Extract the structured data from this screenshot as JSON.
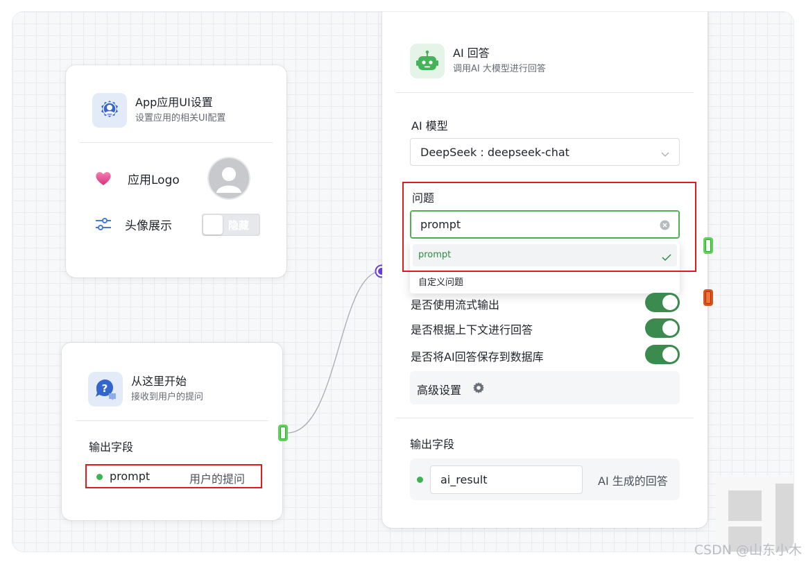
{
  "ui_node": {
    "title": "App应用UI设置",
    "subtitle": "设置应用的相关UI配置",
    "logo_label": "应用Logo",
    "avatar_label": "头像展示",
    "avatar_toggle_text": "隐藏"
  },
  "start_node": {
    "title": "从这里开始",
    "subtitle": "接收到用户的提问",
    "output_label": "输出字段",
    "output_field_name": "prompt",
    "output_field_desc": "用户的提问"
  },
  "ai_node": {
    "title": "AI 回答",
    "subtitle": "调用AI 大模型进行回答",
    "model_label": "AI 模型",
    "model_value": "DeepSeek : deepseek-chat",
    "question_label": "问题",
    "question_value": "prompt",
    "question_options": [
      "prompt",
      "自定义问题"
    ],
    "stream_label": "是否使用流式输出",
    "context_label": "是否根据上下文进行回答",
    "save_label": "是否将AI回答保存到数据库",
    "advanced_label": "高级设置",
    "output_label": "输出字段",
    "output_field_name": "ai_result",
    "output_field_desc": "AI 生成的回答"
  },
  "watermark": "CSDN @山东小木",
  "colors": {
    "accent_green": "#3a8b4d",
    "highlight_red": "#e01919",
    "connector_purple": "#6b3fe0",
    "icon_blue": "#3366cc"
  }
}
